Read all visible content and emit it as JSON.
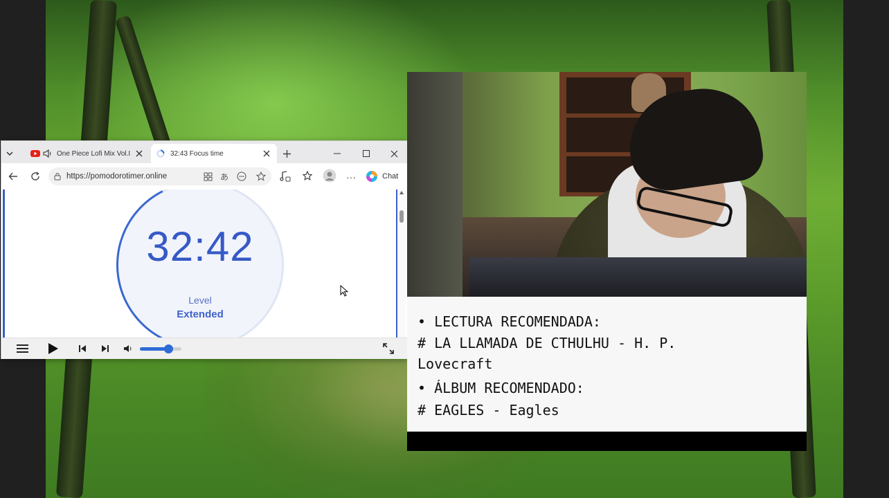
{
  "browser": {
    "tabs": [
      {
        "title": "One Piece Lofi Mix Vol.I",
        "icon": "youtube-icon",
        "audio_icon": "speaker-icon"
      },
      {
        "title": "32:43 Focus time",
        "icon": "loading-spinner-icon"
      }
    ],
    "new_tab_icon": "plus-icon",
    "window_controls": [
      "minimize-icon",
      "maximize-icon",
      "close-icon"
    ],
    "url": "https://pomodorotimer.online",
    "chat_label": "Chat",
    "accent_color": "#3a68cf"
  },
  "timer": {
    "time": "32:42",
    "level_label": "Level",
    "level_value": "Extended"
  },
  "player": {
    "volume_fraction": 0.68,
    "icons": [
      "menu-icon",
      "play-icon",
      "previous-icon",
      "next-icon",
      "volume-icon",
      "fullscreen-icon"
    ]
  },
  "notes": {
    "line1": "• LECTURA RECOMENDADA:",
    "line2": "# LA LLAMADA DE CTHULHU - H. P.",
    "line3": "Lovecraft",
    "line4": "• ÁLBUM RECOMENDADO:",
    "line5": "# EAGLES - Eagles"
  }
}
